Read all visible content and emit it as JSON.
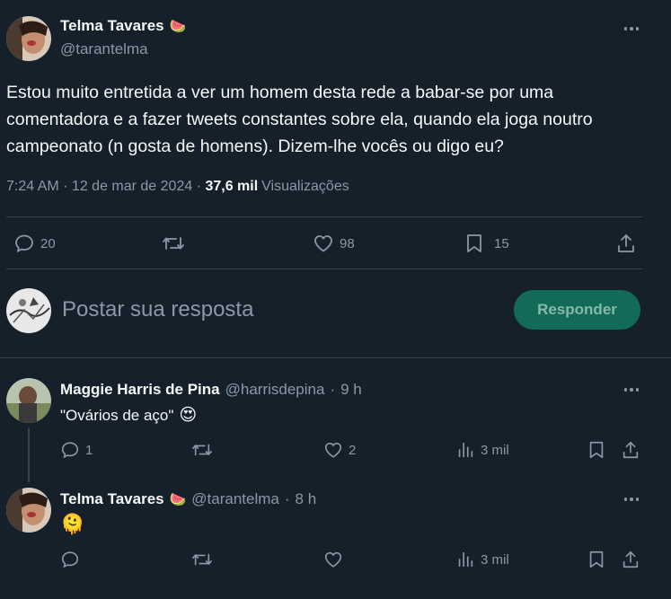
{
  "main_tweet": {
    "author_name": "Telma Tavares",
    "author_emoji": "🍉",
    "handle": "@tarantelma",
    "text": "Estou muito entretida a ver um homem desta rede a babar-se por uma comentadora e a fazer tweets constantes sobre ela, quando ela joga noutro campeonato (n gosta de homens). Dizem-lhe vocês ou digo eu?",
    "time": "7:24 AM",
    "date": "12 de mar de 2024",
    "views_count": "37,6 mil",
    "views_label": "Visualizações",
    "replies": "20",
    "likes": "98",
    "bookmarks": "15"
  },
  "compose": {
    "placeholder": "Postar sua resposta",
    "reply_button": "Responder"
  },
  "replies": [
    {
      "author_name": "Maggie Harris de Pina",
      "handle": "@harrisdepina",
      "time": "9 h",
      "text": "\"Ovários de aço\"",
      "text_emoji": "😍",
      "replies": "1",
      "likes": "2",
      "views": "3 mil"
    },
    {
      "author_name": "Telma Tavares",
      "author_emoji": "🍉",
      "handle": "@tarantelma",
      "time": "8 h",
      "text_emoji": "🫠",
      "views": "3 mil"
    }
  ],
  "colors": {
    "background": "#15202b",
    "text": "#f7f9f9",
    "muted": "#8b98a5",
    "divider": "#38444d",
    "reply_button": "#116b58"
  }
}
